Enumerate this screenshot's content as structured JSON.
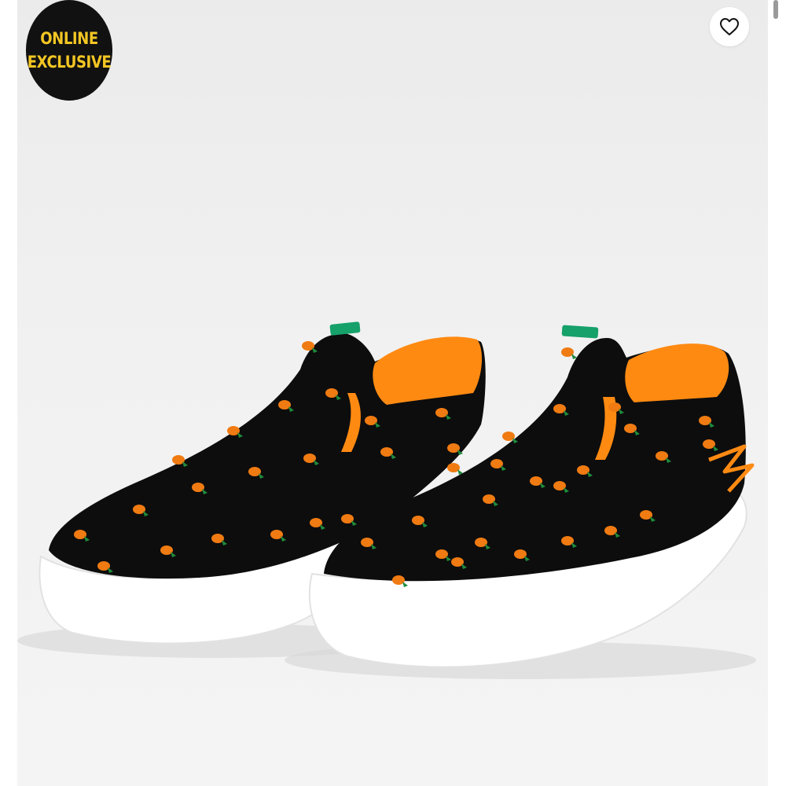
{
  "badge": {
    "line1": "ONLINE",
    "line2": "EXCLUSIVE",
    "text_color": "#f3c623",
    "background": "#111111"
  },
  "favorite": {
    "icon": "heart-outline-icon"
  },
  "product": {
    "colors": {
      "upper": "#0d0d0d",
      "lining": "#ff8a12",
      "sole": "#ffffff",
      "pull_tab": "#16a06a",
      "print_fruit": "#f07b12",
      "print_leaf": "#1e8c3c"
    }
  }
}
